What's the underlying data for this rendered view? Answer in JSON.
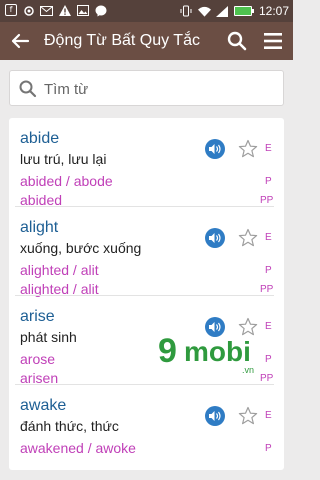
{
  "statusbar": {
    "time": "12:07",
    "left_icons": [
      "notification-f-icon",
      "settings-alert-icon",
      "mail-icon",
      "warning-icon",
      "image-icon",
      "messenger-icon"
    ],
    "right_icons": [
      "vibrate-icon",
      "wifi-icon",
      "signal-icon",
      "battery-icon"
    ]
  },
  "appbar": {
    "title": "Động Từ Bất Quy Tắc",
    "background": "#6b4e44"
  },
  "search": {
    "placeholder": "Tìm từ"
  },
  "tags": {
    "e": "E",
    "p": "P",
    "pp": "PP"
  },
  "watermark": {
    "mark": "9",
    "text": "mobi",
    "suffix": ".vn"
  },
  "entries": [
    {
      "word": "abide",
      "meaning": "lưu trú, lưu lại",
      "past": "abided / abode",
      "participle": "abided"
    },
    {
      "word": "alight",
      "meaning": "xuống, bước xuống",
      "past": "alighted / alit",
      "participle": "alighted / alit"
    },
    {
      "word": "arise",
      "meaning": "phát sinh",
      "past": "arose",
      "participle": "arisen"
    },
    {
      "word": "awake",
      "meaning": "đánh thức, thức",
      "past": "awakened / awoke",
      "participle": ""
    }
  ],
  "colors": {
    "word": "#1e5f94",
    "forms": "#c040b8",
    "audio": "#2f7cc4",
    "status_bar": "#55413b"
  }
}
